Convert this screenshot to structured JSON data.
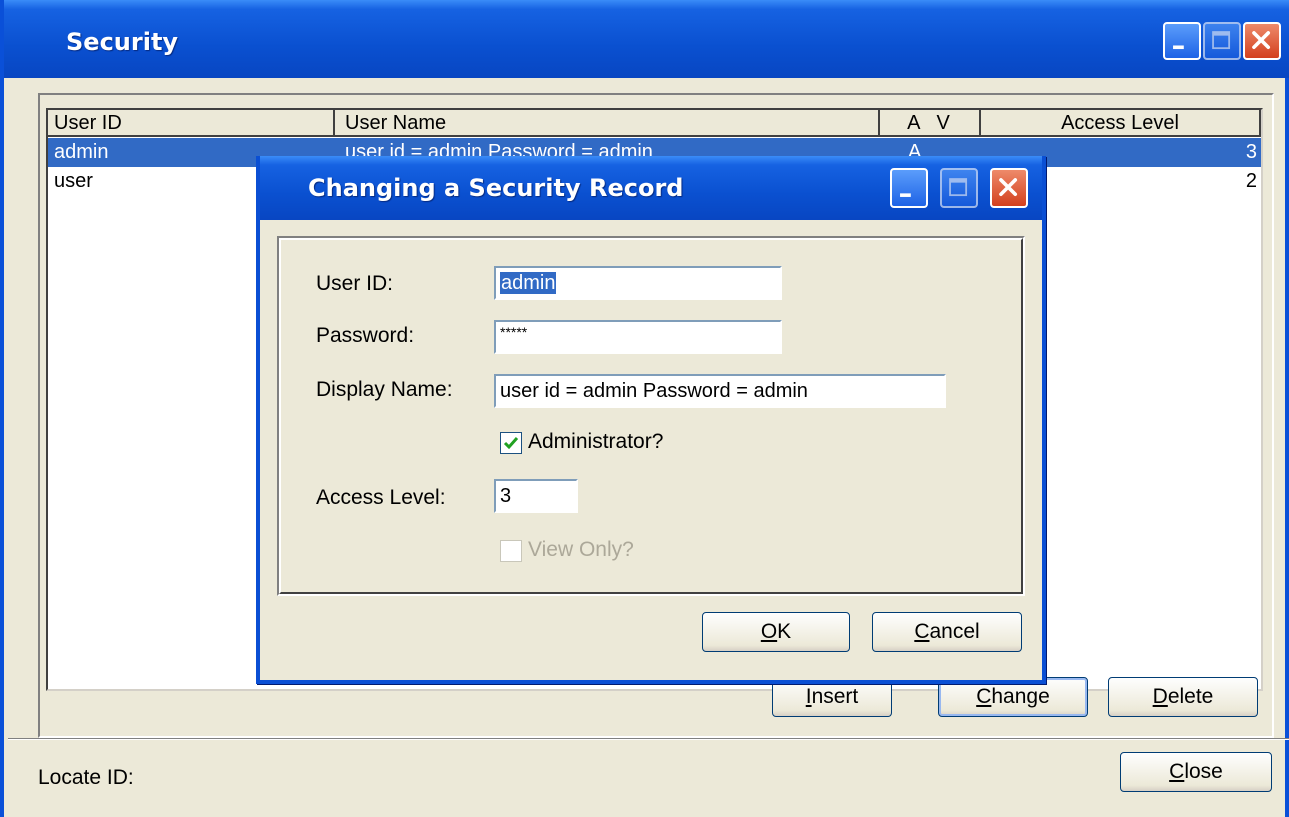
{
  "window": {
    "title": "Security"
  },
  "list": {
    "columns": [
      "User ID",
      "User Name",
      "A  V",
      "Access Level"
    ],
    "rows": [
      {
        "user_id": "admin",
        "user_name": "user id = admin Password = admin",
        "av": "A",
        "level": "3",
        "selected": true
      },
      {
        "user_id": "user",
        "user_name": "",
        "av": "",
        "level": "2",
        "selected": false
      }
    ]
  },
  "buttons": {
    "insert": {
      "pre": "",
      "ul": "I",
      "post": "nsert"
    },
    "change": {
      "pre": "",
      "ul": "C",
      "post": "hange"
    },
    "delete": {
      "pre": "",
      "ul": "D",
      "post": "elete"
    },
    "close": {
      "pre": "",
      "ul": "C",
      "post": "lose"
    }
  },
  "locate": {
    "label": "Locate ID:"
  },
  "dialog": {
    "title": "Changing a Security Record",
    "user_id_label": "User ID:",
    "user_id_value": "admin",
    "password_label": "Password:",
    "password_value": "*****",
    "display_name_label": "Display Name:",
    "display_name_value": "user id = admin Password = admin",
    "administrator_label": "Administrator?",
    "administrator_checked": true,
    "access_level_label": "Access Level:",
    "access_level_value": "3",
    "view_only_label": "View Only?",
    "view_only_checked": false,
    "ok": {
      "pre": "",
      "ul": "O",
      "post": "K"
    },
    "cancel": {
      "pre": "",
      "ul": "C",
      "post": "ancel"
    }
  },
  "colors": {
    "titlebar": "#0a50d0",
    "selection": "#316ac5",
    "face": "#ece9d8"
  }
}
